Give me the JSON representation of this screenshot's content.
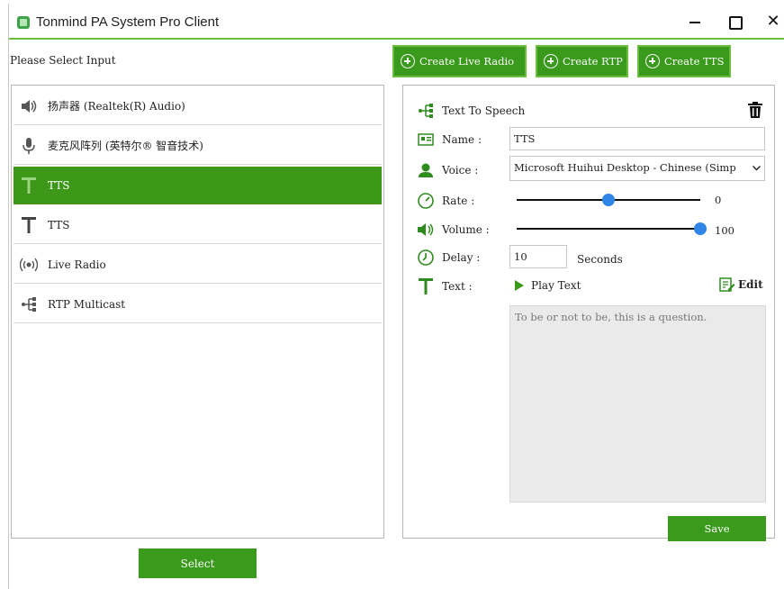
{
  "window": {
    "title": "Tonmind PA System Pro Client",
    "close_glyph": "✕"
  },
  "left": {
    "prompt": "Please Select Input",
    "items": [
      {
        "label": "扬声器 (Realtek(R) Audio)",
        "icon": "speaker-icon"
      },
      {
        "label": "麦克风阵列 (英特尔® 智音技术)",
        "icon": "microphone-icon"
      },
      {
        "label": "TTS",
        "icon": "text-icon",
        "selected": true
      },
      {
        "label": "TTS",
        "icon": "text-icon"
      },
      {
        "label": "Live Radio",
        "icon": "radio-waves-icon"
      },
      {
        "label": "RTP Multicast",
        "icon": "multicast-icon"
      }
    ],
    "select_label": "Select"
  },
  "toolbar": {
    "create_live_radio": "Create Live Radio",
    "create_rtp": "Create RTP",
    "create_tts": "Create TTS"
  },
  "props": {
    "heading": "Text To Speech",
    "name_label": "Name :",
    "name_value": "TTS",
    "voice_label": "Voice :",
    "voice_value": "Microsoft Huihui Desktop - Chinese (Simp",
    "rate_label": "Rate :",
    "rate_value": "0",
    "rate_fraction": 0.5,
    "volume_label": "Volume :",
    "volume_value": "100",
    "volume_fraction": 1.0,
    "delay_label": "Delay :",
    "delay_value": "10",
    "delay_unit": "Seconds",
    "text_label": "Text :",
    "play_text": "Play Text",
    "edit": "Edit",
    "text_content": "To be or not to be, this is a question.",
    "save": "Save"
  },
  "colors": {
    "accent_green": "#3a9a1c",
    "slider_blue": "#2f86e8"
  }
}
